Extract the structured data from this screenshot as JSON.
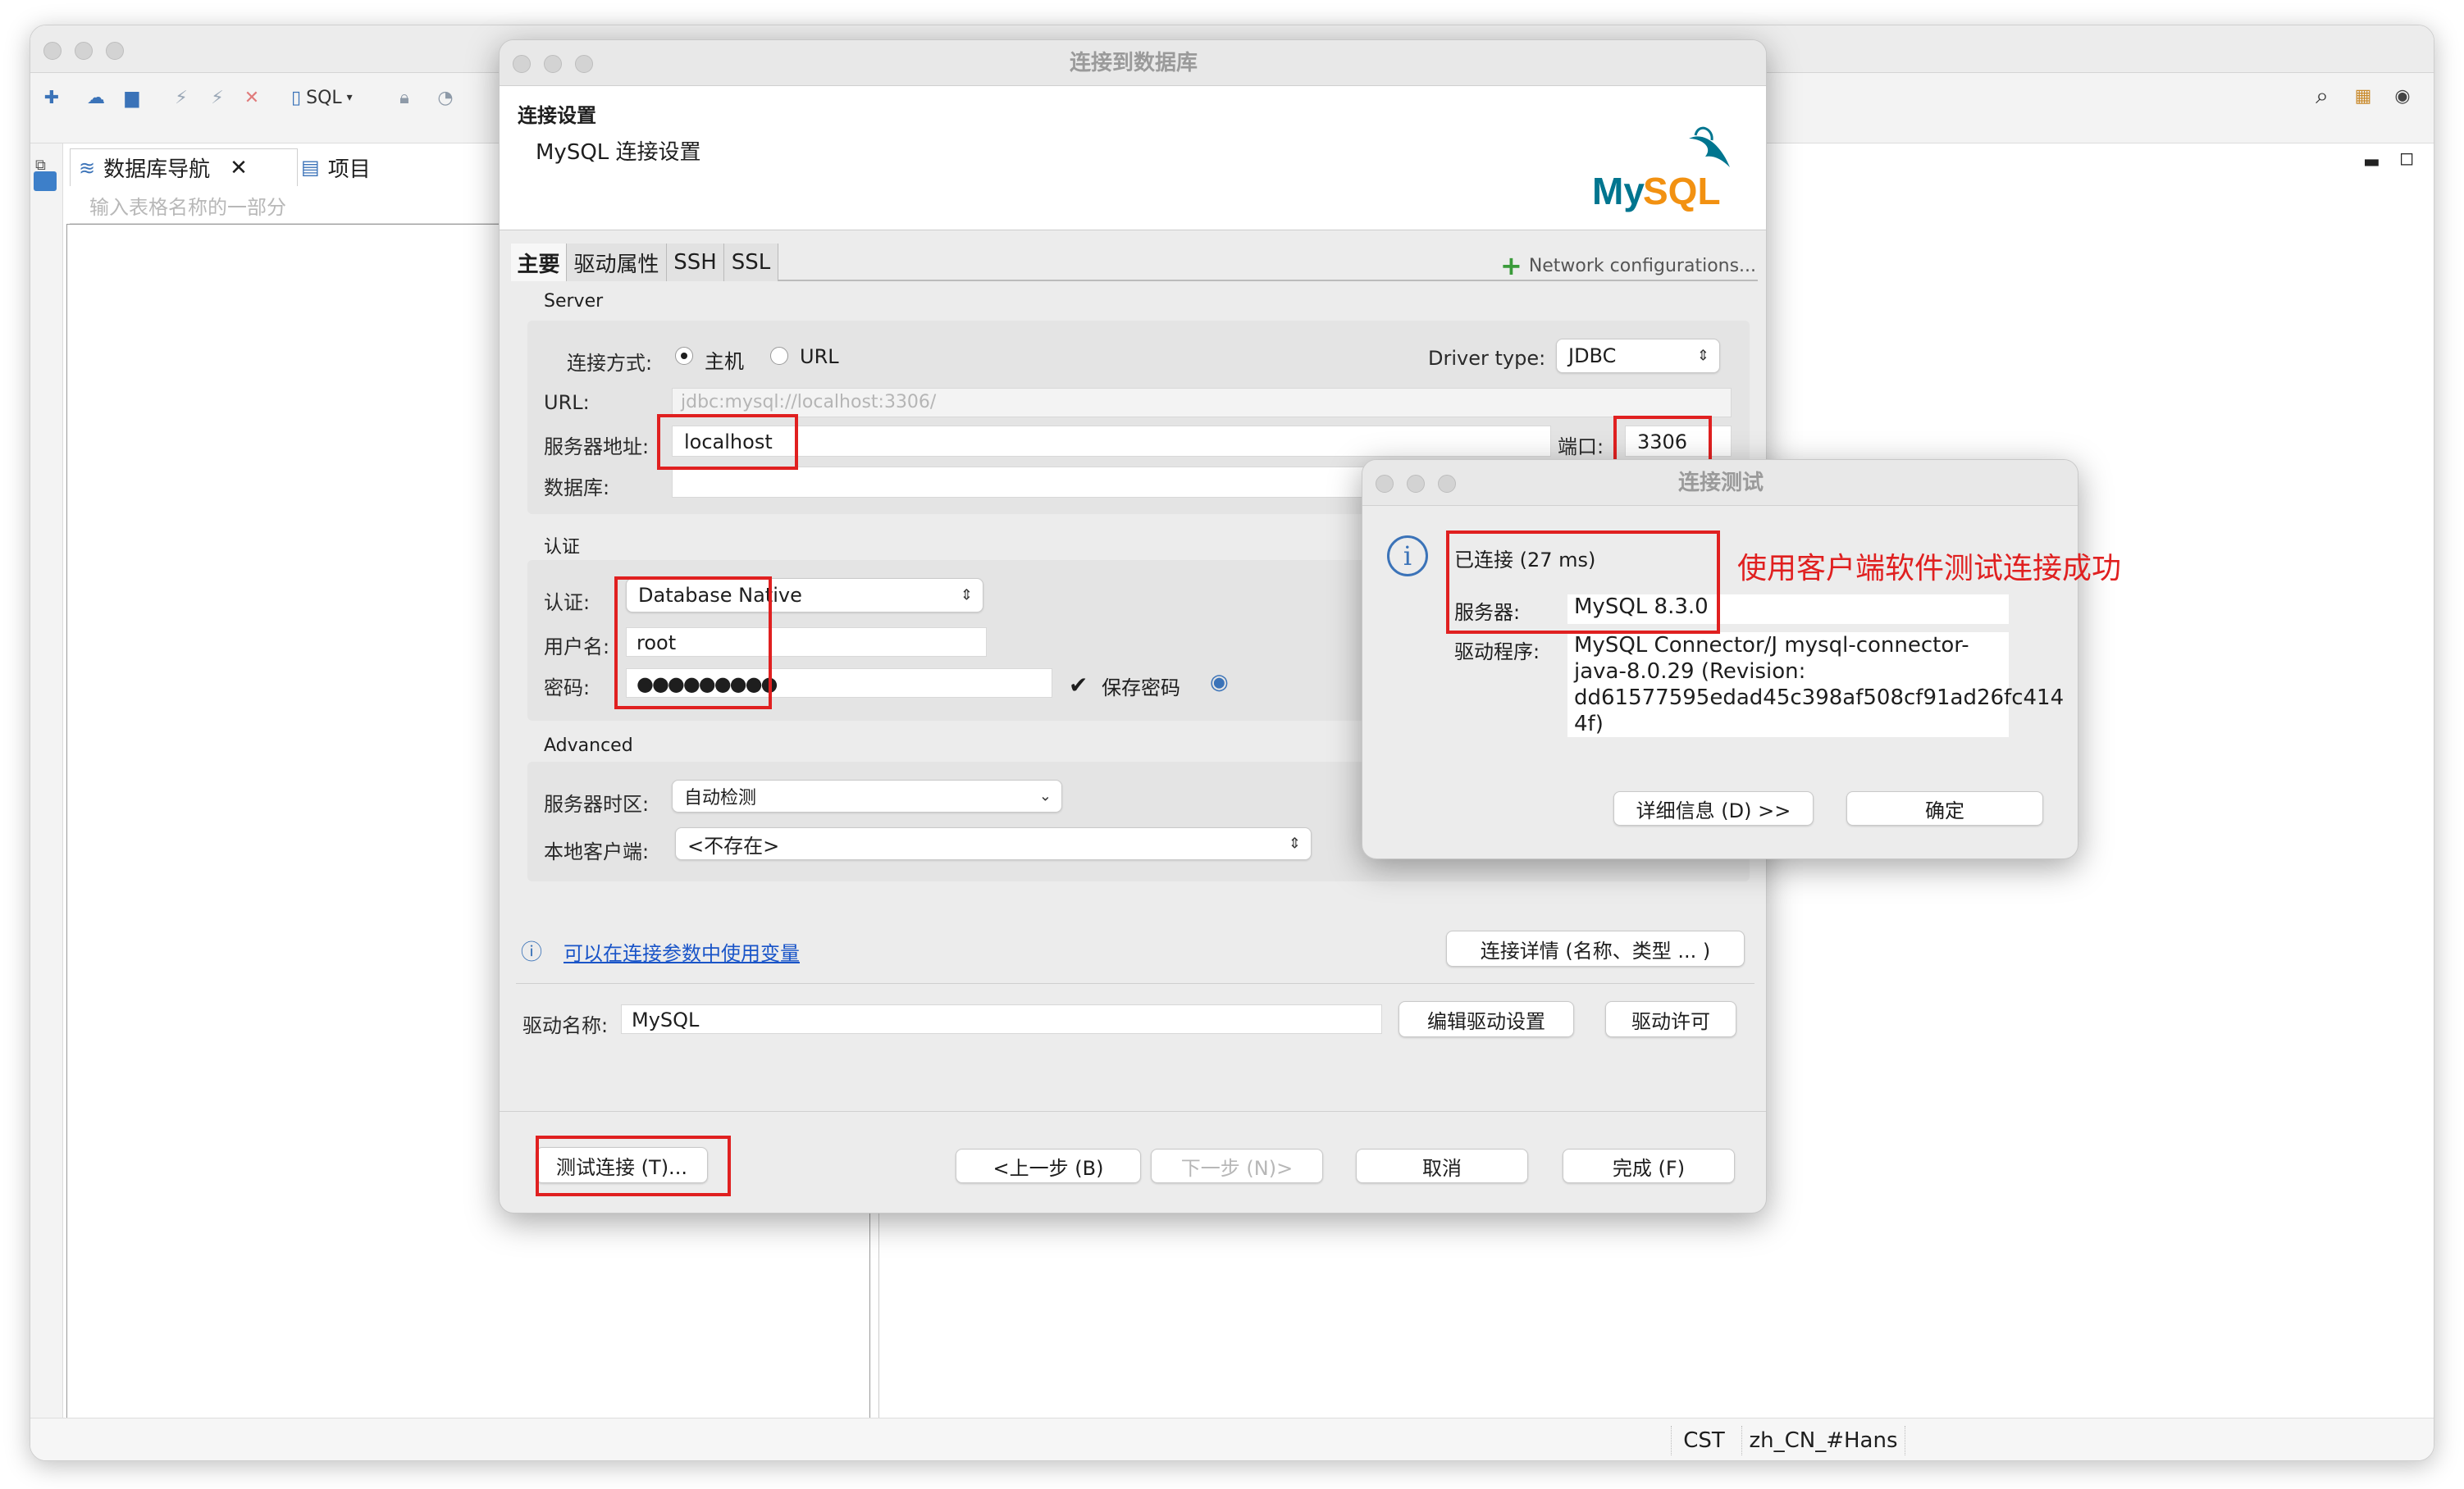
{
  "main": {
    "nav_tab": "数据库导航",
    "project_tab": "项目",
    "filter_placeholder": "输入表格名称的一部分",
    "toolbar_sql": "SQL",
    "status": [
      "CST",
      "zh_CN_#Hans"
    ]
  },
  "dialog": {
    "title": "连接到数据库",
    "header_title": "连接设置",
    "header_subtitle": "MySQL 连接设置",
    "logo_text": "MySQL",
    "tabs": [
      "主要",
      "驱动属性",
      "SSH",
      "SSL"
    ],
    "network_config": "Network configurations...",
    "server_section": "Server",
    "connect_mode_label": "连接方式:",
    "mode_host": "主机",
    "mode_url": "URL",
    "driver_type_label": "Driver type:",
    "driver_type_value": "JDBC",
    "url_label": "URL:",
    "url_value": "jdbc:mysql://localhost:3306/",
    "host_label": "服务器地址:",
    "host_value": "localhost",
    "port_label": "端口:",
    "port_value": "3306",
    "db_label": "数据库:",
    "auth_section": "认证",
    "auth_label": "认证:",
    "auth_value": "Database Native",
    "user_label": "用户名:",
    "user_value": "root",
    "pwd_label": "密码:",
    "pwd_value": "●●●●●●●●●",
    "save_pwd": "保存密码",
    "advanced_section": "Advanced",
    "tz_label": "服务器时区:",
    "tz_value": "自动检测",
    "client_label": "本地客户端:",
    "client_value": "<不存在>",
    "vars_link": "可以在连接参数中使用变量",
    "conn_details_btn": "连接详情 (名称、类型 ... )",
    "driver_name_label": "驱动名称:",
    "driver_name_value": "MySQL",
    "edit_driver_btn": "编辑驱动设置",
    "driver_license_btn": "驱动许可",
    "test_btn": "测试连接 (T)...",
    "back_btn": "<上一步 (B)",
    "next_btn": "下一步 (N)>",
    "cancel_btn": "取消",
    "finish_btn": "完成 (F)"
  },
  "test_dialog": {
    "title": "连接测试",
    "connected": "已连接 (27 ms)",
    "server_label": "服务器:",
    "server_value": "MySQL 8.3.0",
    "driver_label": "驱动程序:",
    "driver_lines": [
      "MySQL Connector/J mysql-connector-",
      "java-8.0.29 (Revision:",
      "dd61577595edad45c398af508cf91ad26fc414",
      "4f)"
    ],
    "details_btn": "详细信息 (D) >>",
    "ok_btn": "确定"
  },
  "annotation": "使用客户端软件测试连接成功",
  "colors": {
    "annotation_red": "#e02020",
    "link_blue": "#1a55c8",
    "mysql_blue": "#00758f",
    "mysql_orange": "#f29111"
  }
}
